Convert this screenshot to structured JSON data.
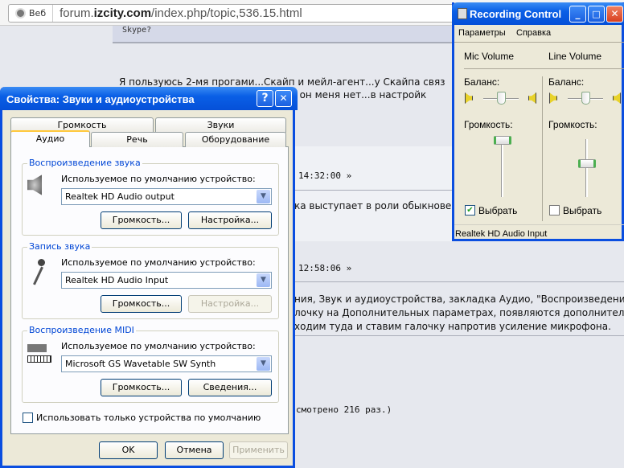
{
  "browser": {
    "web_label": "Веб",
    "url_host_pre": "forum.",
    "url_host_bold": "izcity.com",
    "url_path": "/index.php/topic,536.15.html"
  },
  "page": {
    "quote_text": "Skype?",
    "para1_line1": "Я пользуюсь 2-мя прогами...Скайп и мейл-агент...у Скайпа связ",
    "para1_line2": "ка,а он меня нет...в настройк",
    "post1_time": "14:32:00 »",
    "post1_text": "ка выступает в роли обыкнове",
    "post2_time": "12:58:06 »",
    "post2_lines": [
      "ния, Звук и аудиоустройства, закладка Аудио, \"Воспроизведени",
      "лочку на Дополнительных параметрах, появляются дополнител",
      "ходим туда и ставим галочку напротив усиление микрофона."
    ],
    "views": "смотрено 216 раз.)"
  },
  "dialog": {
    "title": "Свойства: Звуки и аудиоустройства",
    "help": "?",
    "close": "✕",
    "tabs_row1": [
      "Громкость",
      "Звуки"
    ],
    "tabs_row2": [
      "Аудио",
      "Речь",
      "Оборудование"
    ],
    "groups": [
      {
        "title": "Воспроизведение звука",
        "label": "Используемое по умолчанию устройство:",
        "device": "Realtek HD Audio output",
        "btn1": "Громкость...",
        "btn2": "Настройка...",
        "btn2_disabled": false
      },
      {
        "title": "Запись звука",
        "label": "Используемое по умолчанию устройство:",
        "device": "Realtek HD Audio Input",
        "btn1": "Громкость...",
        "btn2": "Настройка...",
        "btn2_disabled": true
      },
      {
        "title": "Воспроизведение MIDI",
        "label": "Используемое по умолчанию устройство:",
        "device": "Microsoft GS Wavetable SW Synth",
        "btn1": "Громкость...",
        "btn2": "Сведения...",
        "btn2_disabled": false
      }
    ],
    "default_only": "Использовать только устройства по умолчанию",
    "default_only_checked": false,
    "ok": "OK",
    "cancel": "Отмена",
    "apply": "Применить"
  },
  "recording": {
    "title": "Recording Control",
    "menu": [
      "Параметры",
      "Справка"
    ],
    "columns": [
      {
        "name": "Mic Volume",
        "balance_label": "Баланс:",
        "balance": 0.5,
        "volume_label": "Громкость:",
        "volume": 1.0,
        "select_label": "Выбрать",
        "selected": true
      },
      {
        "name": "Line Volume",
        "balance_label": "Баланс:",
        "balance": 0.5,
        "volume_label": "Громкость:",
        "volume": 0.5,
        "select_label": "Выбрать",
        "selected": false
      }
    ],
    "status": "Realtek HD Audio Input"
  }
}
